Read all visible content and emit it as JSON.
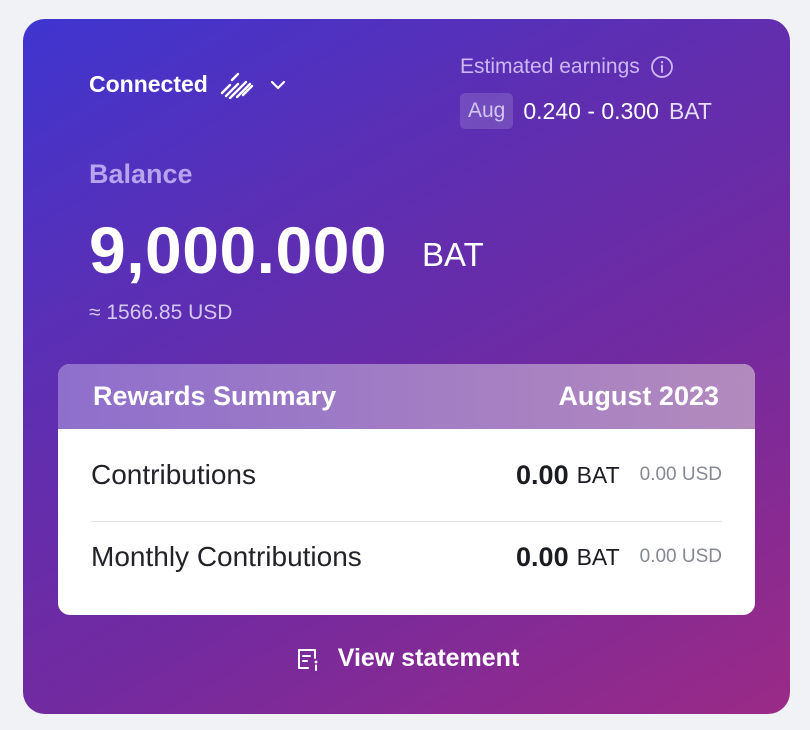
{
  "status": {
    "label": "Connected",
    "icon": "connected-slash-icon",
    "dropdown_icon": "chevron-down-icon"
  },
  "estimated": {
    "label": "Estimated earnings",
    "info_icon": "info-icon",
    "month": "Aug",
    "range": "0.240 - 0.300",
    "unit": "BAT"
  },
  "balance": {
    "label": "Balance",
    "amount": "9,000.000",
    "unit": "BAT",
    "usd": "≈ 1566.85 USD"
  },
  "summary": {
    "title": "Rewards Summary",
    "period": "August 2023",
    "rows": [
      {
        "label": "Contributions",
        "amount": "0.00",
        "unit": "BAT",
        "usd": "0.00 USD"
      },
      {
        "label": "Monthly Contributions",
        "amount": "0.00",
        "unit": "BAT",
        "usd": "0.00 USD"
      }
    ]
  },
  "statement": {
    "label": "View statement",
    "icon": "statement-icon"
  },
  "colors": {
    "gradient_start": "#3f35d0",
    "gradient_end": "#9b2a86",
    "page_bg": "#f1f2f6",
    "summary_header": "#a37ec3"
  }
}
